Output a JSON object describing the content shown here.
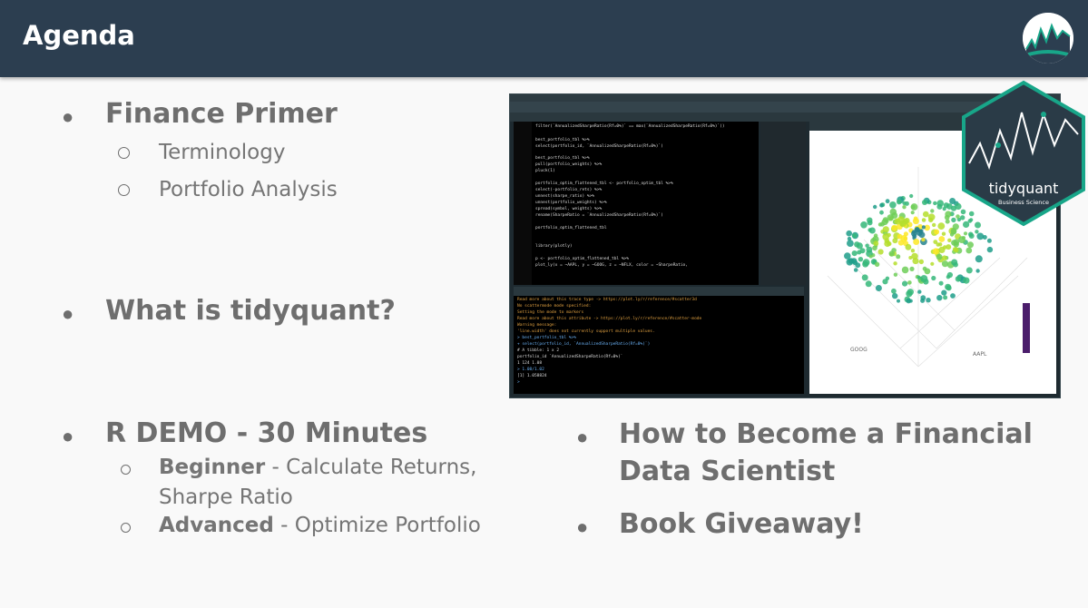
{
  "header": {
    "title": "Agenda"
  },
  "left_items": [
    {
      "label": "Finance Primer",
      "sub": [
        "Terminology",
        "Portfolio Analysis"
      ]
    },
    {
      "label": "What is tidyquant?"
    }
  ],
  "demo": {
    "label": "R DEMO - 30 Minutes",
    "sub": [
      {
        "bold": "Beginner",
        "rest": " - Calculate Returns,",
        "rest2": "Sharpe Ratio"
      },
      {
        "bold": "Advanced",
        "rest": " - Optimize Portfolio"
      }
    ]
  },
  "right_items": [
    {
      "line1": "How to Become a Financial",
      "line2": "Data Scientist"
    },
    {
      "line1": "Book Giveaway!"
    }
  ],
  "badge": {
    "name": "tidyquant",
    "subtitle": "Business Science"
  },
  "code_lines": [
    "filter(`AnnualizedSharpeRatio(Rf=0%)` == max(`AnnualizedSharpeRatio(Rf=0%)`))",
    "best_portfolio_tbl %>%",
    "select(portfolio_id, `AnnualizedSharpeRatio(Rf=0%)`)",
    "best_portfolio_tbl %>%",
    "pull(portfolio_weights) %>%",
    "pluck(1)",
    "portfolio_optim_flattened_tbl <- portfolio_optim_tbl %>%",
    "select(-portfolio_rets) %>%",
    "unnest(sharpe_ratio) %>%",
    "unnest(portfolio_weights) %>%",
    "spread(symbol, weights) %>%",
    "rename(SharpeRatio = `AnnualizedSharpeRatio(Rf=0%)`)",
    "portfolio_optim_flattened_tbl",
    "library(plotly)",
    "p <- portfolio_optim_flattened_tbl %>%",
    "plot_ly(x = ~AAPL, y = ~GOOG, z = ~NFLX, color = ~SharpeRatio,"
  ],
  "console_lines": [
    "Read more about this trace type -> https://plot.ly/r/reference/#scatter3d",
    "No scattermode mode specified:",
    "Setting the mode to markers",
    "Read more about this attribute -> https://plot.ly/r/reference/#scatter-mode",
    "Warning message:",
    "'line.width' does not currently support multiple values.",
    "> best_portfolio_tbl %>%",
    "+   select(portfolio_id, `AnnualizedSharpeRatio(Rf=0%)`)",
    "# A tibble: 1 x 2",
    "  portfolio_id `AnnualizedSharpeRatio(Rf=0%)`",
    "1          124                          1.08",
    "> 1.08/1.02",
    "[1] 1.058824",
    ">"
  ],
  "plot_labels": [
    "GOOG",
    "AAPL"
  ],
  "colors": {
    "header": "#2c3e50",
    "badge": "#2a3b47",
    "teal": "#18a689"
  }
}
